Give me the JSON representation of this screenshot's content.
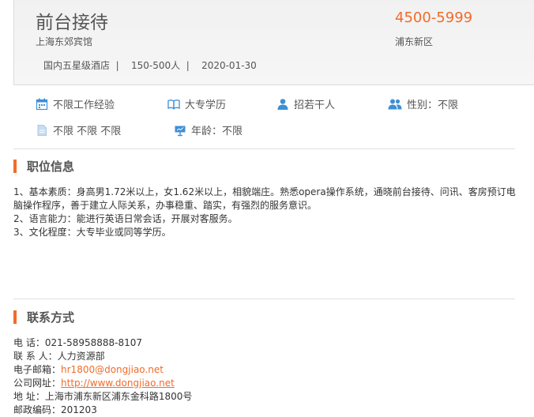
{
  "job": {
    "title": "前台接待",
    "salary": "4500-5999",
    "company": "上海东郊宾馆",
    "area": "浦东新区",
    "company_type": "国内五星级酒店",
    "company_size": "150-500人",
    "date": "2020-01-30",
    "separator": "|"
  },
  "requirements": {
    "experience": "不限工作经验",
    "education": "大专学历",
    "headcount": "招若干人",
    "gender": "性别：不限",
    "misc": "不限 不限 不限",
    "age": "年龄：不限"
  },
  "position_section": {
    "title": "职位信息",
    "lines": [
      "1、基本素质：身高男1.72米以上，女1.62米以上，相貌端庄。熟悉opera操作系统，通晓前台接待、问讯、客房预订电脑操作程序，善于建立人际关系，办事稳重、踏实，有强烈的服务意识。",
      "2、语言能力：能进行英语日常会话，开展对客服务。",
      "3、文化程度：大专毕业或同等学历。"
    ]
  },
  "contact_section": {
    "title": "联系方式",
    "phone_label": "电  话：",
    "phone": "021-58958888-8107",
    "person_label": "联 系 人：",
    "person": "人力资源部",
    "email_label": "电子邮箱：",
    "email": "hr1800@dongjiao.net",
    "website_label": "公司网址：",
    "website": "http://www.dongjiao.net",
    "address_label": "地  址：",
    "address": "上海市浦东新区浦东金科路1800号",
    "postcode_label": "邮政编码：",
    "postcode": "201203"
  },
  "colors": {
    "accent": "#f26b2a",
    "icon_blue": "#3d8fd6"
  }
}
